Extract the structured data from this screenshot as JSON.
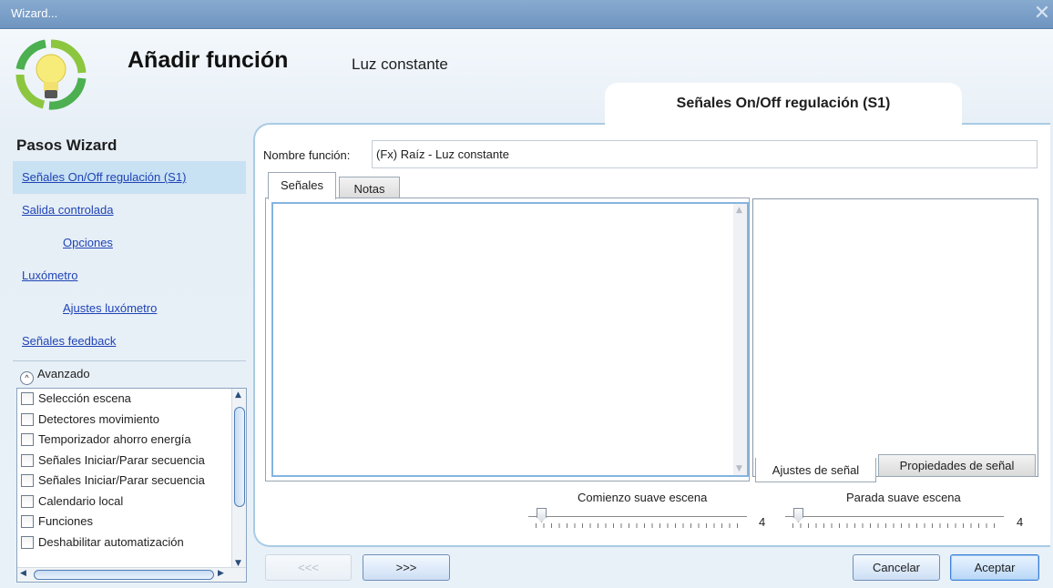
{
  "window": {
    "title": "Wizard...",
    "close_glyph": "✕"
  },
  "header": {
    "title": "Añadir función",
    "function_name": "Luz constante",
    "current_step_tab": "Señales On/Off regulación (S1)",
    "logo_icon": "lightbulb-recycle-icon"
  },
  "sidebar": {
    "heading": "Pasos Wizard",
    "items": [
      {
        "label": "Señales On/Off regulación (S1)",
        "selected": true,
        "indent": false
      },
      {
        "label": "Salida controlada",
        "selected": false,
        "indent": false
      },
      {
        "label": "Opciones",
        "selected": false,
        "indent": true
      },
      {
        "label": "Luxómetro",
        "selected": false,
        "indent": false
      },
      {
        "label": "Ajustes luxómetro",
        "selected": false,
        "indent": true
      },
      {
        "label": "Señales feedback",
        "selected": false,
        "indent": false
      }
    ],
    "advanced_label": "Avanzado",
    "advanced_items": [
      "Selección escena",
      "Detectores movimiento",
      "Temporizador ahorro energía",
      "Señales Iniciar/Parar secuencia",
      "Señales Iniciar/Parar secuencia",
      "Calendario local",
      "Funciones",
      "Deshabilitar automatización"
    ]
  },
  "main": {
    "name_label": "Nombre función:",
    "name_value": "(Fx) Raíz - Luz constante",
    "tabs": [
      {
        "label": "Señales",
        "active": true
      },
      {
        "label": "Notas",
        "active": false
      }
    ],
    "prop_tabs": [
      {
        "label": "Ajustes de señal",
        "active": true
      },
      {
        "label": "Propiedades de señal",
        "active": false
      }
    ],
    "sliders": [
      {
        "label": "Comienzo suave escena",
        "value": "4",
        "position": 0.03
      },
      {
        "label": "Parada suave escena",
        "value": "4",
        "position": 0.03
      }
    ]
  },
  "footer": {
    "prev": "<<<",
    "next": ">>>",
    "cancel": "Cancelar",
    "accept": "Aceptar"
  },
  "colors": {
    "titlebar": "#7a9ec8",
    "link": "#1f44b5",
    "selected_bg": "#c8e1f3",
    "panel_border": "#a9cbe4"
  }
}
